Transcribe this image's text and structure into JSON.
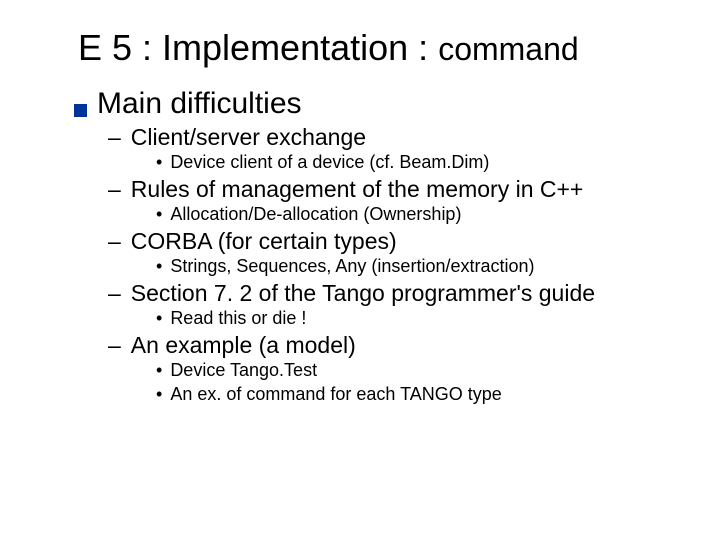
{
  "title_main": "E 5 : Implementation : ",
  "title_tail": "command",
  "l1_main": "Main difficulties",
  "items": [
    {
      "l2": "Client/server exchange",
      "l3": [
        "Device client of a device (cf. Beam.Dim)"
      ]
    },
    {
      "l2": "Rules of management of the memory in C++",
      "l3": [
        "Allocation/De-allocation (Ownership)"
      ]
    },
    {
      "l2": "CORBA (for certain types)",
      "l3": [
        "Strings, Sequences, Any (insertion/extraction)"
      ]
    },
    {
      "l2": "Section 7. 2 of the Tango programmer's guide",
      "l3": [
        "Read this or die !"
      ]
    },
    {
      "l2": "An example (a model)",
      "l3": [
        "Device Tango.Test",
        "An ex. of command for each TANGO type"
      ]
    }
  ]
}
